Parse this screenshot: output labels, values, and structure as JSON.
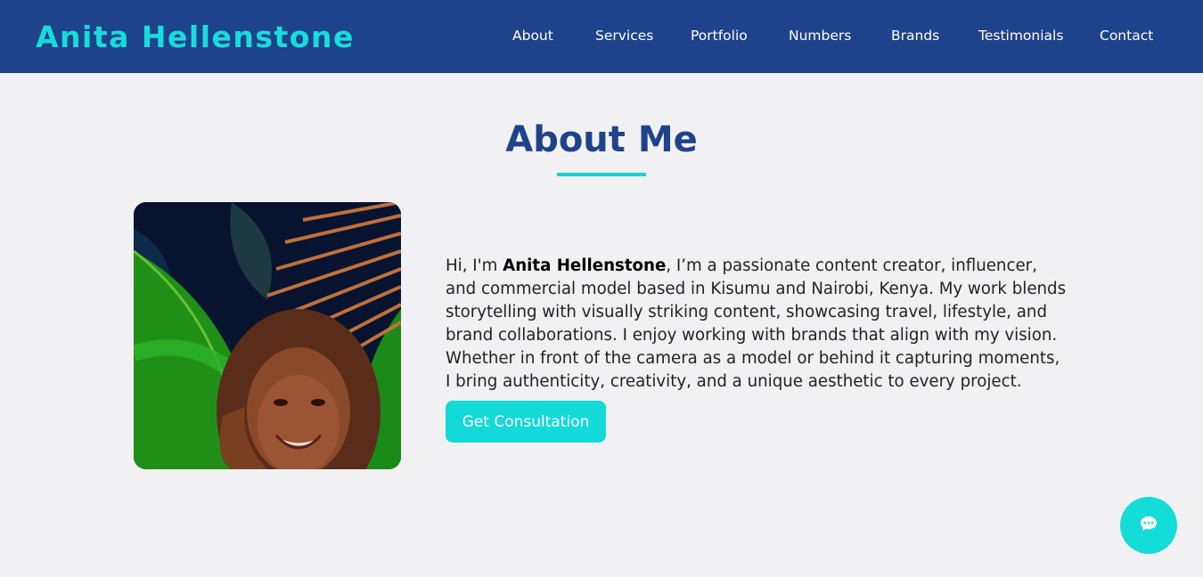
{
  "header": {
    "brand": "Anita Hellenstone",
    "nav": [
      {
        "label": "About"
      },
      {
        "label": "Services"
      },
      {
        "label": "Portfolio"
      },
      {
        "label": "Numbers"
      },
      {
        "label": "Brands"
      },
      {
        "label": "Testimonials"
      },
      {
        "label": "Contact"
      }
    ]
  },
  "about": {
    "title": "About Me",
    "bio_intro": "Hi, I'm ",
    "bio_name": "Anita Hellenstone",
    "bio_rest": ", I’m a passionate content creator, influencer, and commercial model based in Kisumu and Nairobi, Kenya. My work blends storytelling with visually striking content, showcasing travel, lifestyle, and brand collaborations. I enjoy working with brands that align with my vision. Whether in front of the camera as a model or behind it capturing moments, I bring authenticity, creativity, and a unique aesthetic to every project.",
    "cta_label": "Get Consultation"
  },
  "chat": {
    "icon": "chat-icon"
  },
  "colors": {
    "nav_bg": "#1f438a",
    "accent": "#14d9d9",
    "title": "#1f438a",
    "page_bg": "#f1f1f3"
  }
}
